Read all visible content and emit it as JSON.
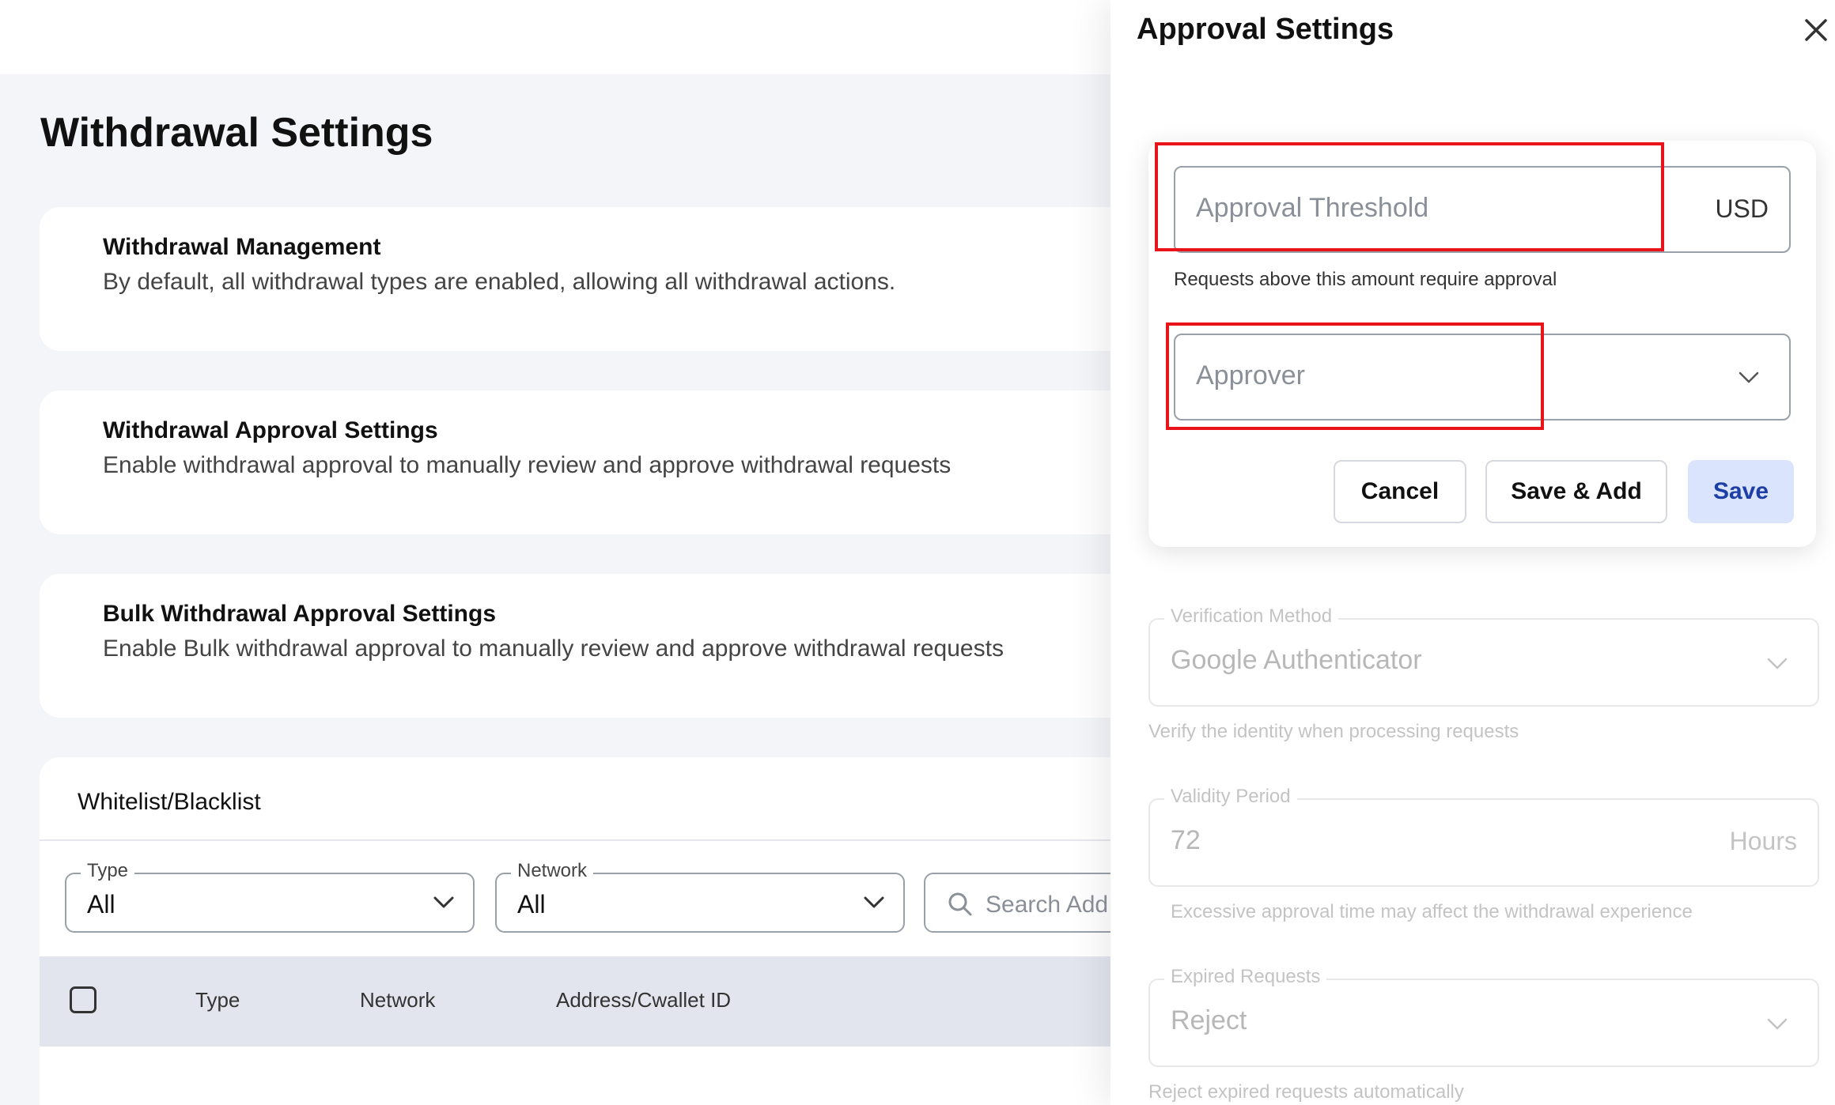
{
  "page": {
    "title": "Withdrawal Settings"
  },
  "cards": [
    {
      "title": "Withdrawal Management",
      "desc": "By default, all withdrawal types are enabled, allowing all withdrawal actions."
    },
    {
      "title": "Withdrawal Approval Settings",
      "desc": "Enable withdrawal approval to manually review and approve withdrawal requests"
    },
    {
      "title": "Bulk Withdrawal Approval Settings",
      "desc": "Enable Bulk withdrawal approval to manually review and approve withdrawal requests"
    }
  ],
  "whitelist": {
    "title": "Whitelist/Blacklist",
    "type_filter": {
      "label": "Type",
      "value": "All"
    },
    "network_filter": {
      "label": "Network",
      "value": "All"
    },
    "search_placeholder": "Search Add",
    "columns": [
      "Type",
      "Network",
      "Address/Cwallet ID"
    ]
  },
  "panel": {
    "title": "Approval Settings",
    "threshold": {
      "placeholder": "Approval Threshold",
      "suffix": "USD",
      "helper": "Requests above this amount require approval"
    },
    "approver": {
      "placeholder": "Approver"
    },
    "buttons": {
      "cancel": "Cancel",
      "save_add": "Save & Add",
      "save": "Save"
    },
    "verification": {
      "label": "Verification Method",
      "value": "Google Authenticator",
      "helper": "Verify the identity when processing requests"
    },
    "validity": {
      "label": "Validity Period",
      "value": "72",
      "suffix": "Hours",
      "helper": "Excessive approval time may affect the withdrawal experience"
    },
    "expired": {
      "label": "Expired Requests",
      "value": "Reject",
      "helper": "Reject expired requests automatically"
    }
  },
  "colors": {
    "highlight": "#e8141a",
    "save_button_bg": "#dbe4fd",
    "save_button_text": "#1d3ea6",
    "page_bg": "#f4f5f9",
    "table_header_bg": "#e2e5ee"
  },
  "icons": {
    "close": "close-icon",
    "chevron": "chevron-down-icon",
    "search": "search-icon"
  }
}
